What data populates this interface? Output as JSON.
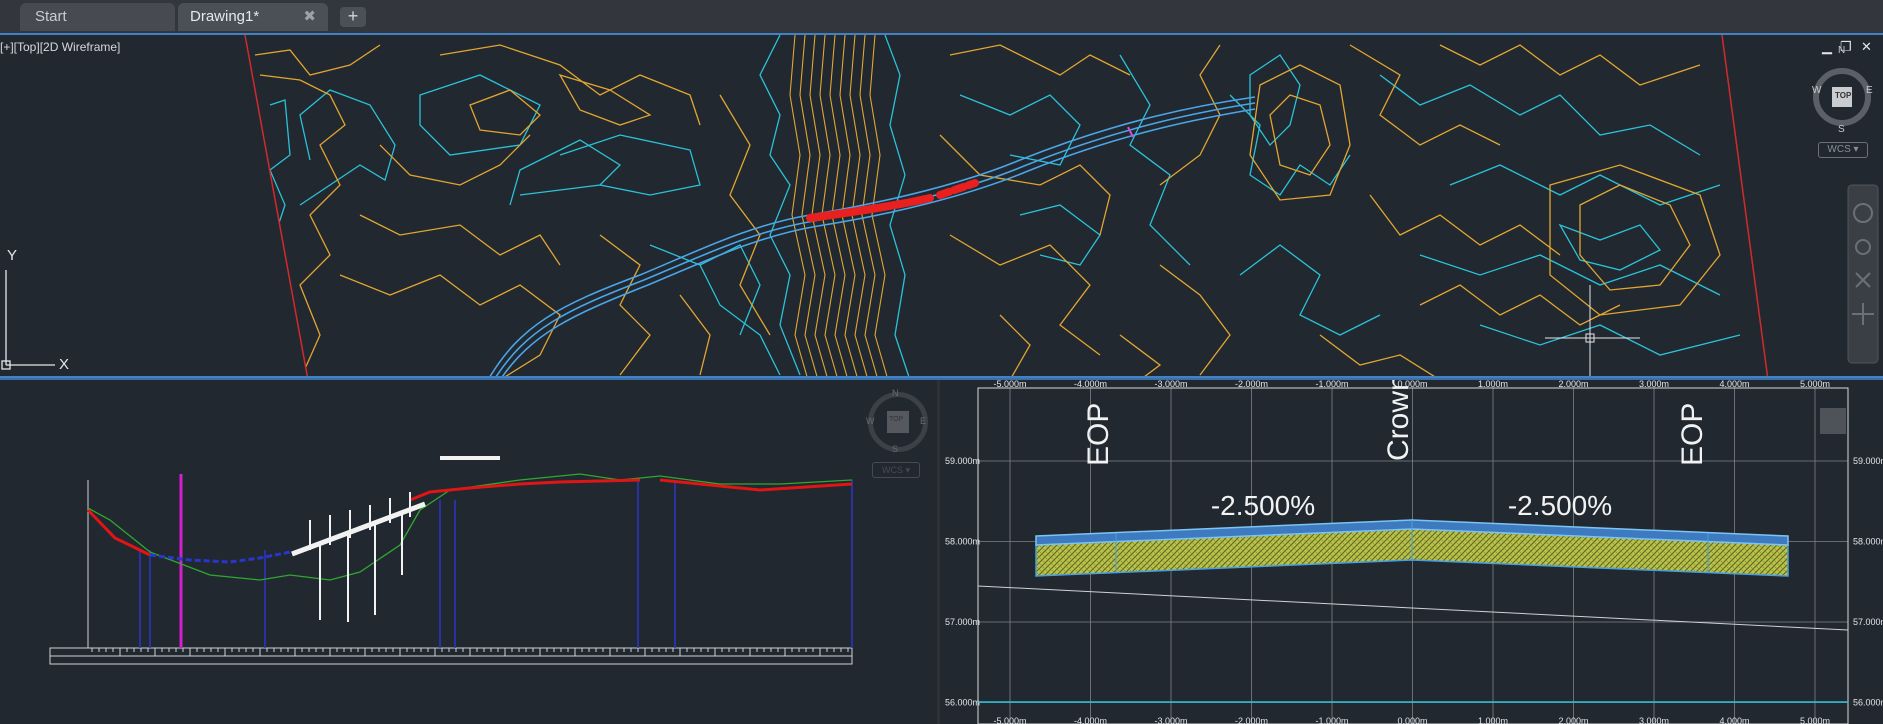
{
  "tabs": [
    {
      "label": "Start",
      "close": ""
    },
    {
      "label": "Drawing1*",
      "close": "✖"
    }
  ],
  "new_tab_glyph": "+",
  "top_viewport": {
    "label": "[+][Top][2D Wireframe]",
    "compass": {
      "n": "N",
      "s": "S",
      "e": "E",
      "w": "W",
      "center": "TOP"
    },
    "wcs": "WCS ▾",
    "ucs": {
      "y": "Y",
      "x": "X"
    },
    "window_controls": [
      "▁",
      "❐",
      "✕"
    ]
  },
  "profile_viewport": {
    "compass": {
      "n": "N",
      "s": "S",
      "e": "E",
      "w": "W",
      "center": "TOP"
    },
    "wcs": "WCS ▾"
  },
  "section_viewport": {
    "x_ticks": [
      "-5.000m",
      "-4.000m",
      "-3.000m",
      "-2.000m",
      "-1.000m",
      "0.000m",
      "1.000m",
      "2.000m",
      "3.000m",
      "4.000m",
      "5.000m"
    ],
    "y_ticks": [
      "59.000m",
      "58.000m",
      "57.000m",
      "56.000m"
    ],
    "labels": {
      "crown": "Crown",
      "eop_left": "EOP",
      "eop_right": "EOP"
    },
    "slopes": {
      "left": "-2.500%",
      "right": "-2.500%"
    }
  },
  "colors": {
    "background": "#212830",
    "contour_major": "#e2a630",
    "contour_minor": "#2bc2d8",
    "alignment": "#4aa6e8",
    "highlight": "#e82020",
    "viewport_border": "#3f82c7"
  }
}
